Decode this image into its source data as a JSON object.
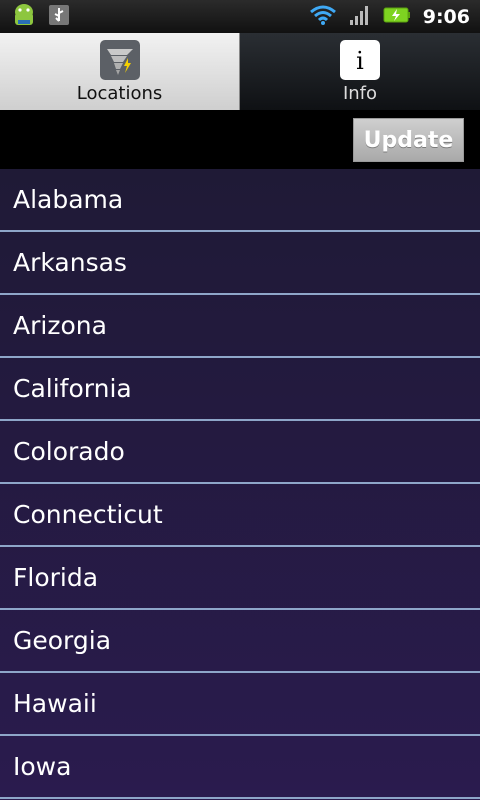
{
  "status_bar": {
    "time": "9:06",
    "icons": [
      "android-icon",
      "usb-icon",
      "wifi-icon",
      "signal-icon",
      "battery-charging-icon"
    ]
  },
  "tabs": [
    {
      "label": "Locations",
      "icon": "tornado-icon",
      "active": true
    },
    {
      "label": "Info",
      "icon": "info-icon",
      "active": false
    }
  ],
  "toolbar": {
    "update_label": "Update"
  },
  "locations": [
    "Alabama",
    "Arkansas",
    "Arizona",
    "California",
    "Colorado",
    "Connecticut",
    "Florida",
    "Georgia",
    "Hawaii",
    "Iowa"
  ],
  "colors": {
    "list_bg_top": "#1f1a36",
    "list_bg_bottom": "#2a1b4e",
    "divider": "#8ea6c9",
    "battery_green": "#7ed321",
    "wifi_blue": "#3fa9f5"
  }
}
